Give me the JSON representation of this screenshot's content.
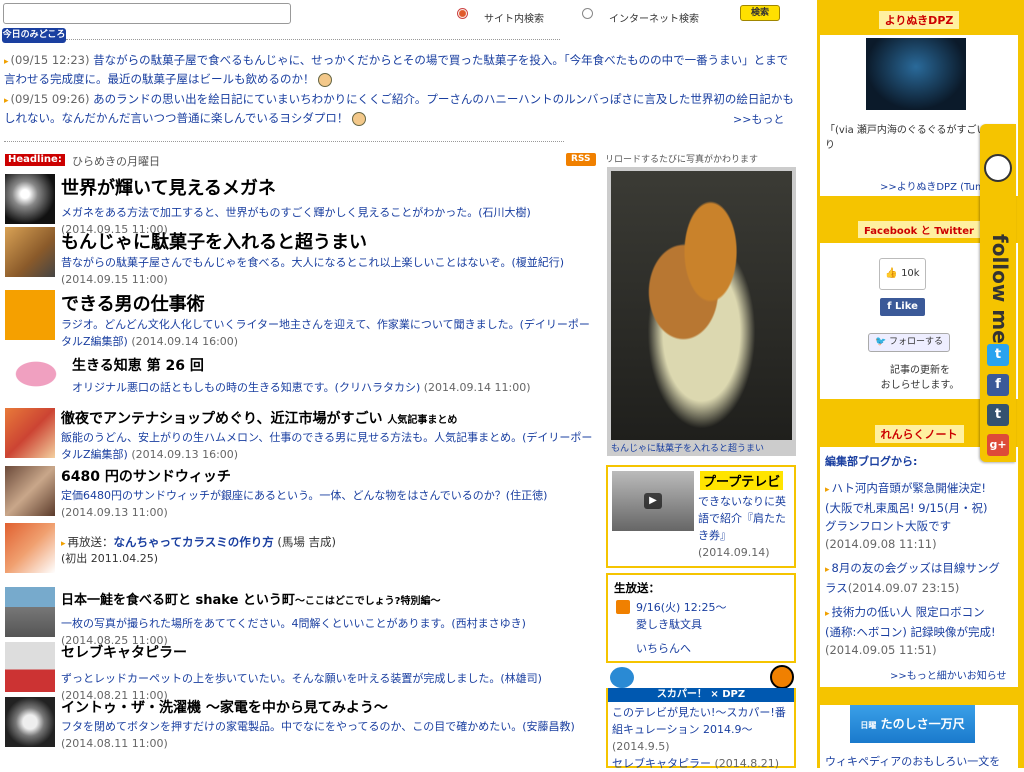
{
  "search": {
    "option_site": "サイト内検索",
    "option_internet": "インターネット検索",
    "button": "検索"
  },
  "today_label": "今日のみどころ",
  "news": [
    {
      "date": "(09/15 12:23)",
      "text": "昔ながらの駄菓子屋で食べるもんじゃに、せっかくだからとその場で買った駄菓子を投入。「今年食べたものの中で一番うまい」とまで言わせる完成度に。最近の駄菓子屋はビールも飲めるのか！"
    },
    {
      "date": "(09/15 09:26)",
      "text": "あのランドの思い出を絵日記にていまいちわかりにくくご紹介。プーさんのハニーハントのルンバっぽさに言及した世界初の絵日記かもしれない。なんだかんだ言いつつ普通に楽しんでいるヨシダプロ！"
    }
  ],
  "more_label": ">>もっと",
  "headline": {
    "tag": "Headline:",
    "subtitle": "ひらめきの月曜日",
    "rss": "RSS",
    "reload_note": "リロードするたびに写真がかわります"
  },
  "articles": [
    {
      "title": "世界が輝いて見えるメガネ",
      "desc": "メガネをある方法で加工すると、世界がものすごく輝かしく見えることがわかった。(石川大樹)",
      "date": "(2014.09.15 11:00)"
    },
    {
      "title": "もんじゃに駄菓子を入れると超うまい",
      "desc": "昔ながらの駄菓子屋さんでもんじゃを食べる。大人になるとこれ以上楽しいことはないぞ。(榎並紀行)",
      "date": "(2014.09.15 11:00)"
    },
    {
      "title": "できる男の仕事術",
      "desc": "ラジオ。どんどん文化人化していくライター地主さんを迎えて、作家業について聞きました。(デイリーポータルZ編集部)",
      "date": "(2014.09.14 16:00)"
    },
    {
      "title": "生きる知恵 第 26 回",
      "desc": "オリジナル悪口の話ともしもの時の生きる知恵です。(クリハラタカシ)",
      "date": "(2014.09.14 11:00)"
    },
    {
      "title": "徹夜でアンテナショップめぐり、近江市場がすごい",
      "title_suffix": "人気記事まとめ",
      "desc": "飯能のうどん、安上がりの生ハムメロン、仕事のできる男に見せる方法も。人気記事まとめ。(デイリーポータルZ編集部)",
      "date": "(2014.09.13 16:00)"
    },
    {
      "title": "6480 円のサンドウィッチ",
      "desc": "定価6480円のサンドウィッチが銀座にあるという。一体、どんな物をはさんでいるのか？(住正徳)",
      "date": "(2014.09.13 11:00)"
    }
  ],
  "rerun": {
    "label": "再放送：",
    "title": "なんちゃってカラスミの作り方",
    "author": "(馬場 吉成)",
    "orig": "(初出 2011.04.25)"
  },
  "articles2": [
    {
      "title": "日本一鮭を食べる町と shake という町",
      "title_suffix": "〜ここはどこでしょう?特別編〜",
      "desc": "一枚の写真が撮られた場所をあててください。4問解くといいことがあります。(西村まさゆき)",
      "date": "(2014.08.25 11:00)"
    },
    {
      "title": "セレブキャタピラー",
      "desc": "ずっとレッドカーペットの上を歩いていたい。そんな願いを叶える装置が完成しました。(林雄司)",
      "date": "(2014.08.21 11:00)"
    },
    {
      "title": "イントゥ・ザ・洗濯機 〜家電を中から見てみよう〜",
      "desc": "フタを閉めてボタンを押すだけの家電製品。中でなにをやってるのか、この目で確かめたい。(安藤昌教)",
      "date": "(2014.08.11 11:00)"
    }
  ],
  "photo_caption": "もんじゃに駄菓子を入れると超うまい",
  "puppu": {
    "logo": "プープテレビ",
    "text": "できないなりに英語で紹介『肩たたき券』",
    "date": "(2014.09.14)"
  },
  "live": {
    "title": "生放送：",
    "datetime": "9/16(火) 12:25〜",
    "program": "愛しき駄文具",
    "list_link": "いちらんへ"
  },
  "skyperfect": {
    "header": "スカパー！ × DPZ",
    "item1": "このテレビが見たい!〜スカパー!番組キュレーション 2014.9〜",
    "item1_date": "(2014.9.5)",
    "item2": "セレブキャタピラー",
    "item2_date": "(2014.8.21)"
  },
  "right": {
    "yorinuki_title": "よりぬきDPZ",
    "yorinuki_text": "「(via 瀬戸内海のぐるぐるがすごい」より",
    "yorinuki_link": ">>よりぬきDPZ (Tum",
    "fb_title": "Facebook と Twitter",
    "like_count": "10k",
    "like_label": "Like",
    "follow_label": "フォローする",
    "follow_note": "記事の更新を\nおしらせします。",
    "renraku_title": "れんらくノート",
    "blog_head": "編集部ブログから:",
    "blog_items": [
      {
        "text": "ハト河内音頭が緊急開催決定!(大阪で札束風呂! 9/15(月・祝) グランフロント大阪です",
        "date": "(2014.09.08 11:11)"
      },
      {
        "text": "8月の友の会グッズは目線サングラス",
        "date": "(2014.09.07 23:15)"
      },
      {
        "text": "技術力の低い人 限定ロボコン(通称:ヘボコン) 記録映像が完成!",
        "date": "(2014.09.05 11:51)"
      }
    ],
    "blog_more": ">>もっと細かいお知らせ",
    "banner_text": "たのしさ一万尺",
    "banner_small": "日曜",
    "wiki_text": "ウィキペディアのおもしろい一文を"
  },
  "follow_me": "follow me",
  "colors": {
    "accent": "#f5c400",
    "link": "#1a3fa0",
    "headline": "#cc0000"
  }
}
